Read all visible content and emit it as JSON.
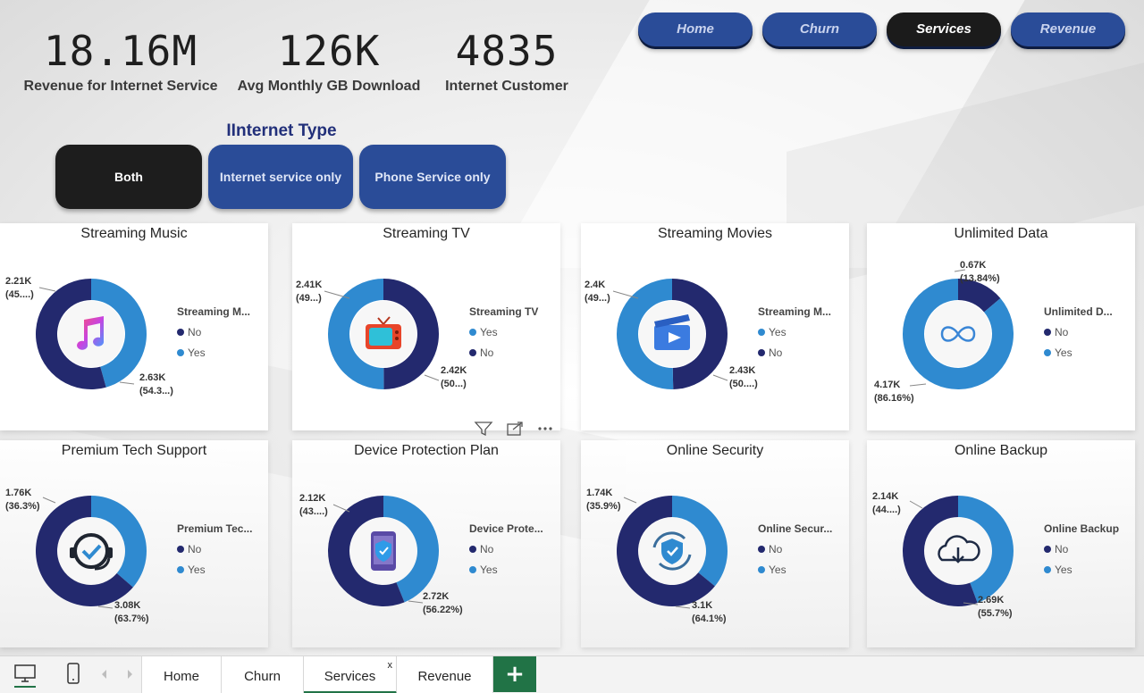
{
  "kpis": [
    {
      "value": "18.16M",
      "label": "Revenue for Internet Service"
    },
    {
      "value": "126K",
      "label": "Avg Monthly GB Download"
    },
    {
      "value": "4835",
      "label": "Internet Customer"
    }
  ],
  "nav": [
    {
      "label": "Home",
      "active": false
    },
    {
      "label": "Churn",
      "active": false
    },
    {
      "label": "Services",
      "active": true
    },
    {
      "label": "Revenue",
      "active": false
    }
  ],
  "internet_type": {
    "title": "IInternet Type",
    "options": [
      {
        "label": "Both",
        "active": true
      },
      {
        "label": "Internet service only",
        "active": false
      },
      {
        "label": "Phone Service only",
        "active": false
      }
    ]
  },
  "colors": {
    "dark": "#23296e",
    "light": "#2f8ad0"
  },
  "chart_data": [
    {
      "type": "pie",
      "title": "Streaming Music",
      "icon": "music-note-icon",
      "legend_title": "Streaming M...",
      "legend": [
        "No",
        "Yes"
      ],
      "legend_colors": [
        "#23296e",
        "#2f8ad0"
      ],
      "slices": [
        {
          "name": "Yes",
          "value": 2210,
          "label": "2.21K",
          "pct": "(45....)",
          "color": "#2f8ad0"
        },
        {
          "name": "No",
          "value": 2630,
          "label": "2.63K",
          "pct": "(54.3...)",
          "color": "#23296e"
        }
      ]
    },
    {
      "type": "pie",
      "title": "Streaming TV",
      "icon": "television-icon",
      "legend_title": "Streaming TV",
      "legend": [
        "Yes",
        "No"
      ],
      "legend_colors": [
        "#2f8ad0",
        "#23296e"
      ],
      "slices": [
        {
          "name": "No",
          "value": 2410,
          "label": "2.41K",
          "pct": "(49...)",
          "color": "#23296e"
        },
        {
          "name": "Yes",
          "value": 2420,
          "label": "2.42K",
          "pct": "(50...)",
          "color": "#2f8ad0"
        }
      ]
    },
    {
      "type": "pie",
      "title": "Streaming Movies",
      "icon": "movie-clapper-icon",
      "legend_title": "Streaming M...",
      "legend": [
        "Yes",
        "No"
      ],
      "legend_colors": [
        "#2f8ad0",
        "#23296e"
      ],
      "slices": [
        {
          "name": "No",
          "value": 2400,
          "label": "2.4K",
          "pct": "(49...)",
          "color": "#23296e"
        },
        {
          "name": "Yes",
          "value": 2430,
          "label": "2.43K",
          "pct": "(50....)",
          "color": "#2f8ad0"
        }
      ]
    },
    {
      "type": "pie",
      "title": "Unlimited Data",
      "icon": "infinity-icon",
      "legend_title": "Unlimited D...",
      "legend": [
        "No",
        "Yes"
      ],
      "legend_colors": [
        "#23296e",
        "#2f8ad0"
      ],
      "slices": [
        {
          "name": "No",
          "value": 670,
          "label": "0.67K",
          "pct": "(13.84%)",
          "color": "#23296e"
        },
        {
          "name": "Yes",
          "value": 4170,
          "label": "4.17K",
          "pct": "(86.16%)",
          "color": "#2f8ad0"
        }
      ]
    },
    {
      "type": "pie",
      "title": "Premium Tech Support",
      "icon": "headset-support-icon",
      "legend_title": "Premium Tec...",
      "legend": [
        "No",
        "Yes"
      ],
      "legend_colors": [
        "#23296e",
        "#2f8ad0"
      ],
      "slices": [
        {
          "name": "Yes",
          "value": 1760,
          "label": "1.76K",
          "pct": "(36.3%)",
          "color": "#2f8ad0"
        },
        {
          "name": "No",
          "value": 3080,
          "label": "3.08K",
          "pct": "(63.7%)",
          "color": "#23296e"
        }
      ]
    },
    {
      "type": "pie",
      "title": "Device Protection Plan",
      "icon": "phone-shield-icon",
      "legend_title": "Device Prote...",
      "legend": [
        "No",
        "Yes"
      ],
      "legend_colors": [
        "#23296e",
        "#2f8ad0"
      ],
      "slices": [
        {
          "name": "Yes",
          "value": 2120,
          "label": "2.12K",
          "pct": "(43....)",
          "color": "#2f8ad0"
        },
        {
          "name": "No",
          "value": 2720,
          "label": "2.72K",
          "pct": "(56.22%)",
          "color": "#23296e"
        }
      ]
    },
    {
      "type": "pie",
      "title": "Online Security",
      "icon": "security-check-icon",
      "legend_title": "Online Secur...",
      "legend": [
        "No",
        "Yes"
      ],
      "legend_colors": [
        "#23296e",
        "#2f8ad0"
      ],
      "slices": [
        {
          "name": "Yes",
          "value": 1740,
          "label": "1.74K",
          "pct": "(35.9%)",
          "color": "#2f8ad0"
        },
        {
          "name": "No",
          "value": 3100,
          "label": "3.1K",
          "pct": "(64.1%)",
          "color": "#23296e"
        }
      ]
    },
    {
      "type": "pie",
      "title": "Online Backup",
      "icon": "cloud-download-icon",
      "legend_title": "Online Backup",
      "legend": [
        "No",
        "Yes"
      ],
      "legend_colors": [
        "#23296e",
        "#2f8ad0"
      ],
      "slices": [
        {
          "name": "Yes",
          "value": 2140,
          "label": "2.14K",
          "pct": "(44....)",
          "color": "#2f8ad0"
        },
        {
          "name": "No",
          "value": 2690,
          "label": "2.69K",
          "pct": "(55.7%)",
          "color": "#23296e"
        }
      ]
    }
  ],
  "tabs": [
    {
      "label": "Home",
      "active": false
    },
    {
      "label": "Churn",
      "active": false
    },
    {
      "label": "Services",
      "active": true,
      "close": "x"
    },
    {
      "label": "Revenue",
      "active": false
    }
  ],
  "add_tab": "+"
}
